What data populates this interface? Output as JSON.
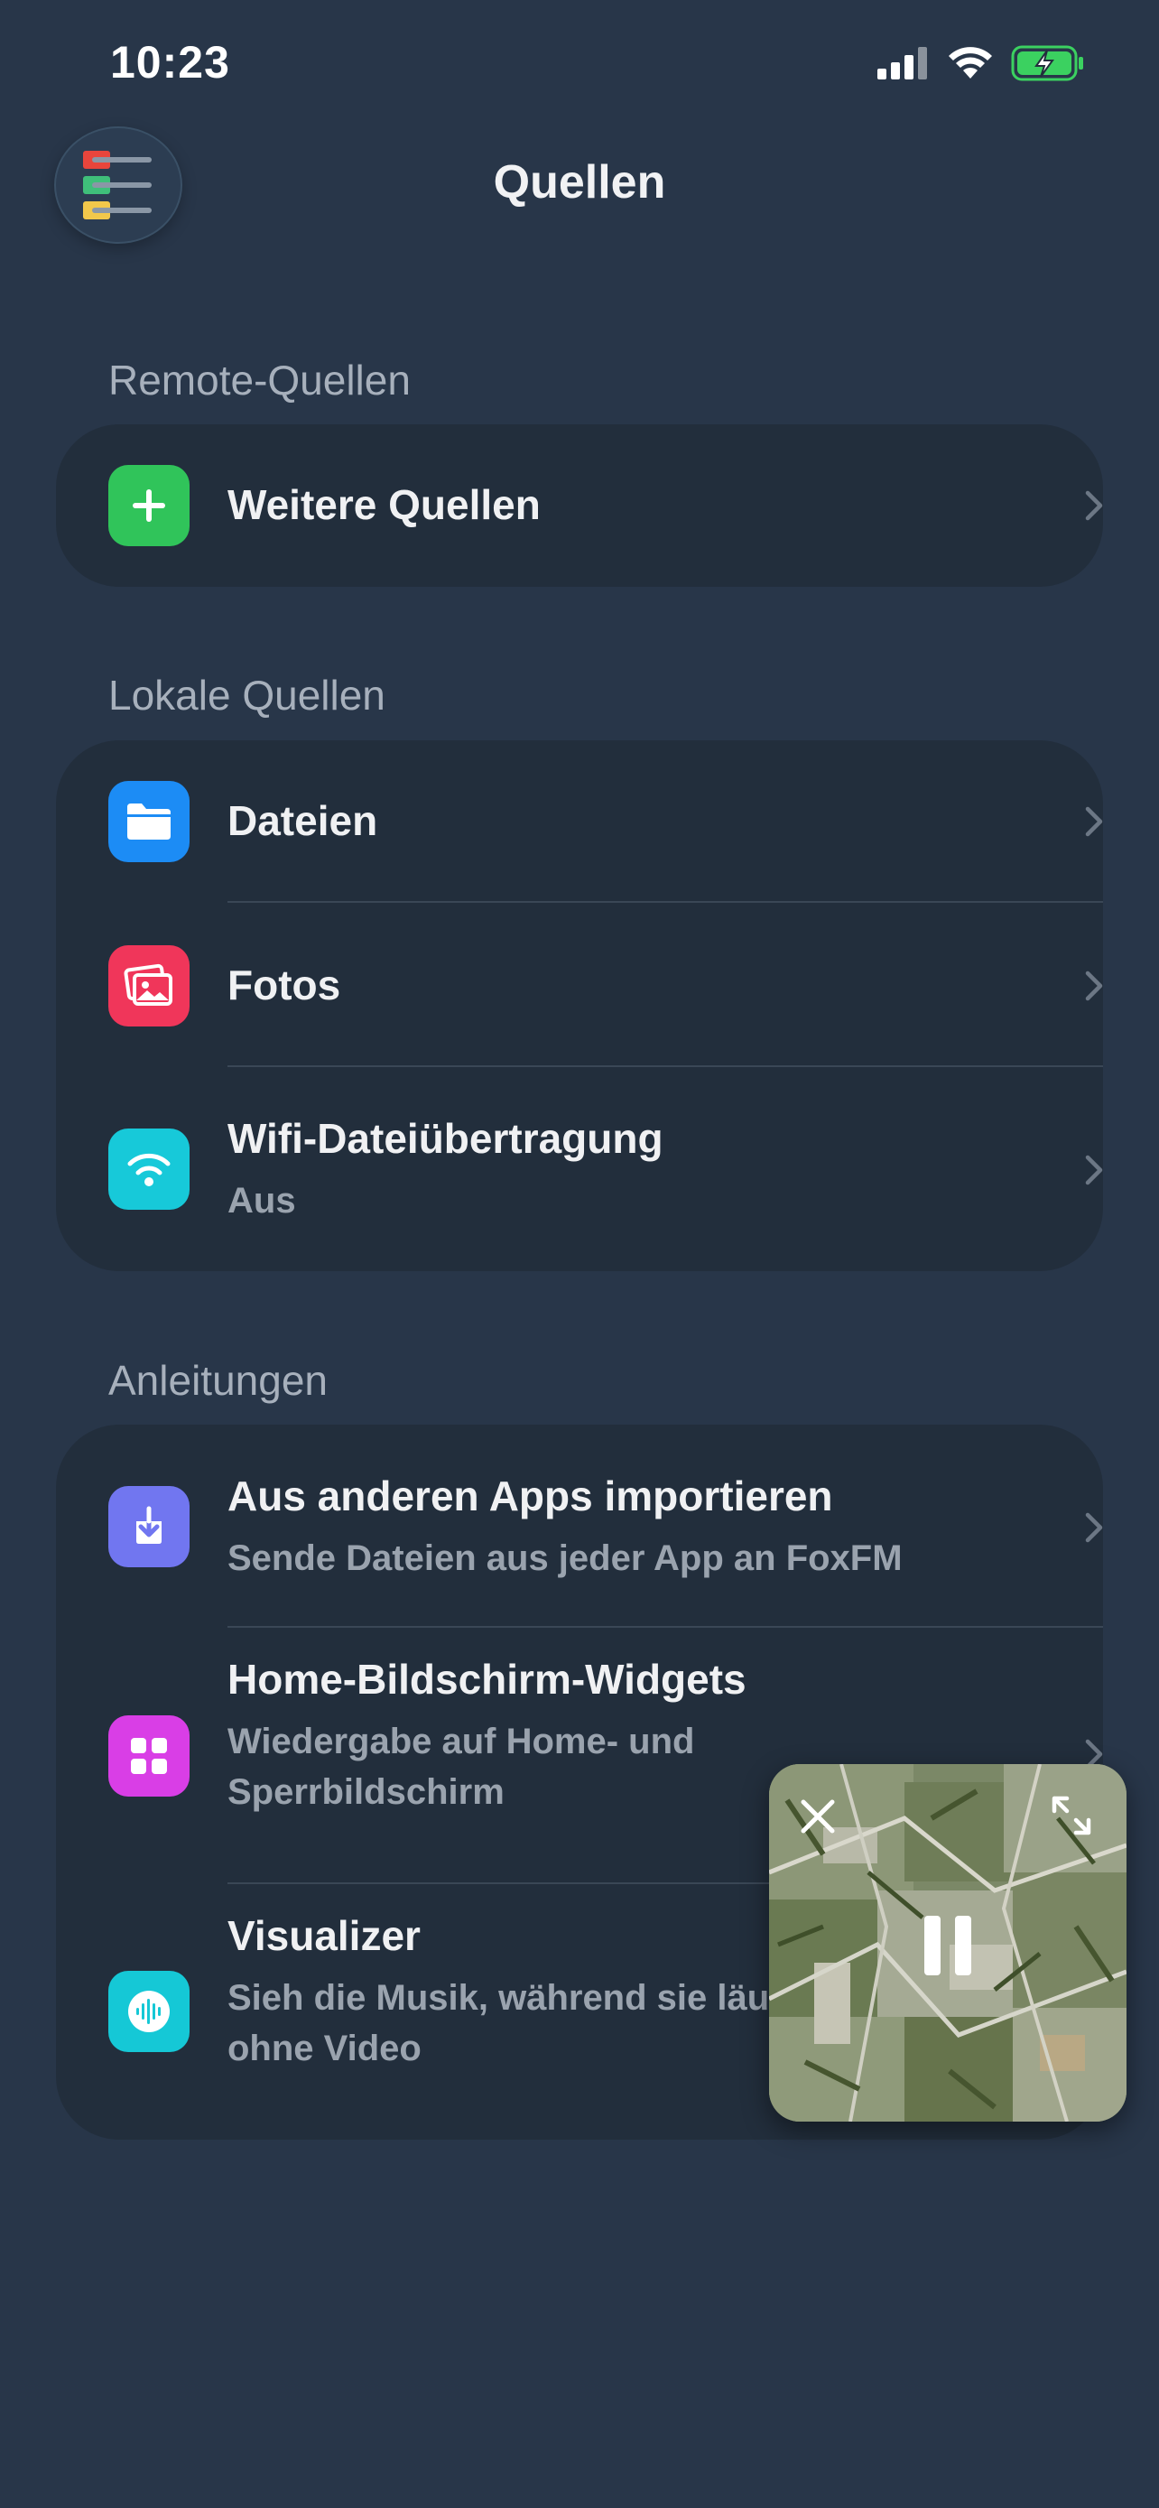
{
  "status_bar": {
    "time": "10:23"
  },
  "header": {
    "title": "Quellen",
    "menu_icon": "menu-list-icon"
  },
  "sections": {
    "remote": {
      "title": "Remote-Quellen",
      "items": [
        {
          "title": "Weitere Quellen",
          "icon": "plus-icon",
          "icon_color": "#30c45a"
        }
      ]
    },
    "local": {
      "title": "Lokale Quellen",
      "items": [
        {
          "title": "Dateien",
          "icon": "folder-icon",
          "icon_color": "#1c8cf5"
        },
        {
          "title": "Fotos",
          "icon": "photos-icon",
          "icon_color": "#f0365a"
        },
        {
          "title": "Wifi-Dateiübertragung",
          "subtitle": "Aus",
          "icon": "wifi-icon",
          "icon_color": "#17c9d9"
        }
      ]
    },
    "guides": {
      "title": "Anleitungen",
      "items": [
        {
          "title": "Aus anderen Apps importieren",
          "subtitle": "Sende Dateien aus jeder App an FoxFM",
          "icon": "import-icon",
          "icon_color": "#7176f0"
        },
        {
          "title": "Home-Bildschirm-Widgets",
          "subtitle_line1": "Wiedergabe auf Home- und",
          "subtitle_line2": "Sperrbildschirm",
          "icon": "widgets-icon",
          "icon_color": "#d93ee6"
        },
        {
          "title": "Visualizer",
          "subtitle_line1": "Sieh die Musik, während sie läu",
          "subtitle_line2": "ohne Video",
          "icon": "waveform-icon",
          "icon_color": "#15c8d6"
        }
      ]
    }
  },
  "mini_player": {
    "close_icon": "close-icon",
    "expand_icon": "expand-icon",
    "pause_icon": "pause-icon"
  }
}
